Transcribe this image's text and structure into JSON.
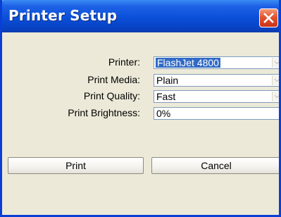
{
  "window": {
    "title": "Printer Setup"
  },
  "form": {
    "printer": {
      "label": "Printer:",
      "value": "FlashJet 4800"
    },
    "print_media": {
      "label": "Print Media:",
      "value": "Plain"
    },
    "print_quality": {
      "label": "Print Quality:",
      "value": "Fast"
    },
    "print_brightness": {
      "label": "Print Brightness:",
      "value": "0%"
    }
  },
  "buttons": {
    "print": "Print",
    "cancel": "Cancel"
  },
  "colors": {
    "titlebar": "#0a4fd8",
    "selection": "#316ac5",
    "close_button": "#e3532e",
    "dialog_background": "#ece9d8"
  },
  "icons": {
    "close": "close-icon",
    "dropdown": "chevron-down-icon"
  }
}
